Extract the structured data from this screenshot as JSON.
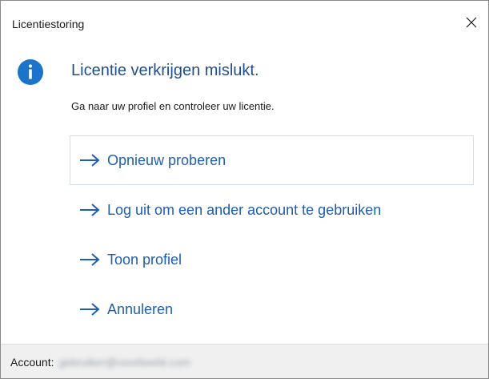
{
  "window": {
    "title": "Licentiestoring",
    "close_glyph": "✕"
  },
  "message": {
    "icon": "info-icon",
    "heading": "Licentie verkrijgen mislukt.",
    "body": "Ga naar uw profiel en controleer uw licentie."
  },
  "options": [
    {
      "label": "Opnieuw proberen",
      "focused": true
    },
    {
      "label": "Log uit om een ander account te gebruiken",
      "focused": false
    },
    {
      "label": "Toon profiel",
      "focused": false
    },
    {
      "label": "Annuleren",
      "focused": false
    }
  ],
  "footer": {
    "account_label": "Account:",
    "account_value": "gebruiker@voorbeeld.com"
  },
  "colors": {
    "accent": "#1f5fae",
    "heading": "#1f4f8f",
    "info_icon": "#1b74c9",
    "footer_bg": "#f0f0f0"
  }
}
